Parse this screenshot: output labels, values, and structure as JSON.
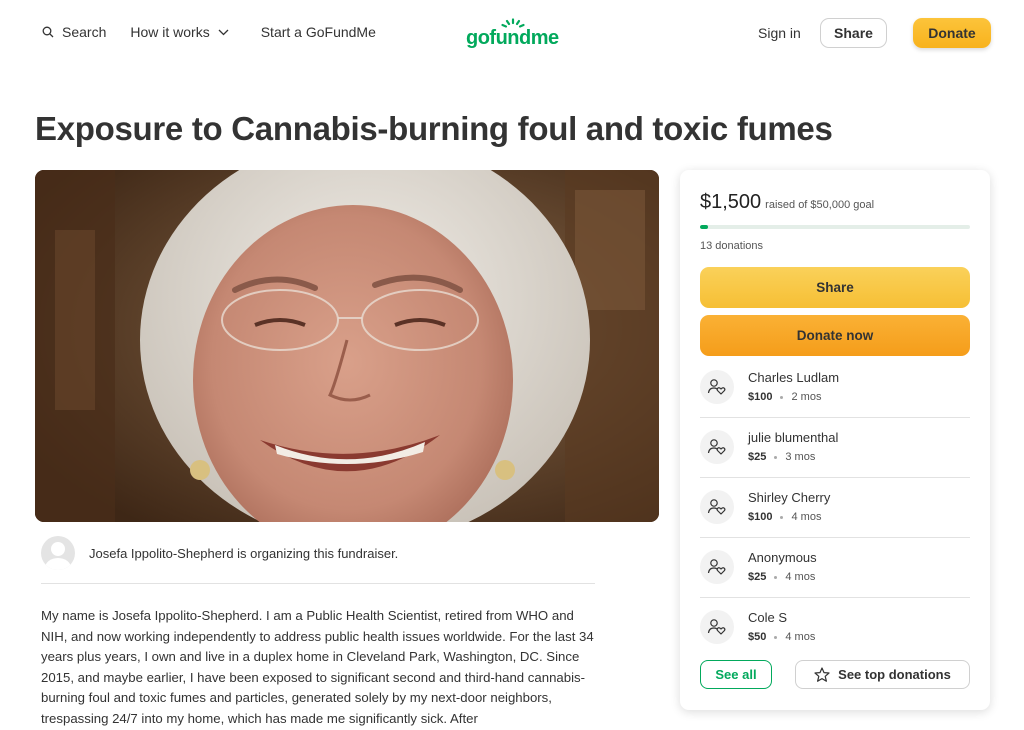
{
  "header": {
    "search_label": "Search",
    "how_it_works_label": "How it works",
    "start_label": "Start a GoFundMe",
    "logo_text": "gofundme",
    "signin_label": "Sign in",
    "share_label": "Share",
    "donate_label": "Donate"
  },
  "campaign": {
    "title": "Exposure to Cannabis-burning foul and toxic fumes",
    "organizer_text": "Josefa Ippolito-Shepherd is organizing this fundraiser.",
    "story": "My name is Josefa Ippolito-Shepherd. I am a Public Health Scientist, retired from WHO and NIH, and now working independently to address public health issues worldwide. For the last 34 years plus years, I own and live in a duplex home in Cleveland Park, Washington, DC. Since 2015, and maybe earlier, I have been exposed to significant second and third-hand cannabis-burning foul and toxic fumes and particles, generated solely by my next-door neighbors, trespassing 24/7 into my home, which has made me significantly sick. After"
  },
  "sidebar": {
    "raised_amount": "$1,500",
    "goal_text": "raised of $50,000 goal",
    "progress_fraction": 0.03,
    "donation_count": "13 donations",
    "share_label": "Share",
    "donate_label": "Donate now",
    "donations": [
      {
        "name": "Charles Ludlam",
        "amount": "$100",
        "time": "2 mos"
      },
      {
        "name": "julie blumenthal",
        "amount": "$25",
        "time": "3 mos"
      },
      {
        "name": "Shirley Cherry",
        "amount": "$100",
        "time": "4 mos"
      },
      {
        "name": "Anonymous",
        "amount": "$25",
        "time": "4 mos"
      },
      {
        "name": "Cole S",
        "amount": "$50",
        "time": "4 mos"
      }
    ],
    "see_all_label": "See all",
    "top_donations_label": "See top donations"
  },
  "colors": {
    "brand_green": "#02a95c",
    "donate_yellow": "#f8b21d",
    "donate_orange": "#f59d1a"
  },
  "icons": {
    "search": "search-icon",
    "chevron": "chevron-down-icon",
    "donor": "donor-heart-icon",
    "star": "star-icon"
  }
}
